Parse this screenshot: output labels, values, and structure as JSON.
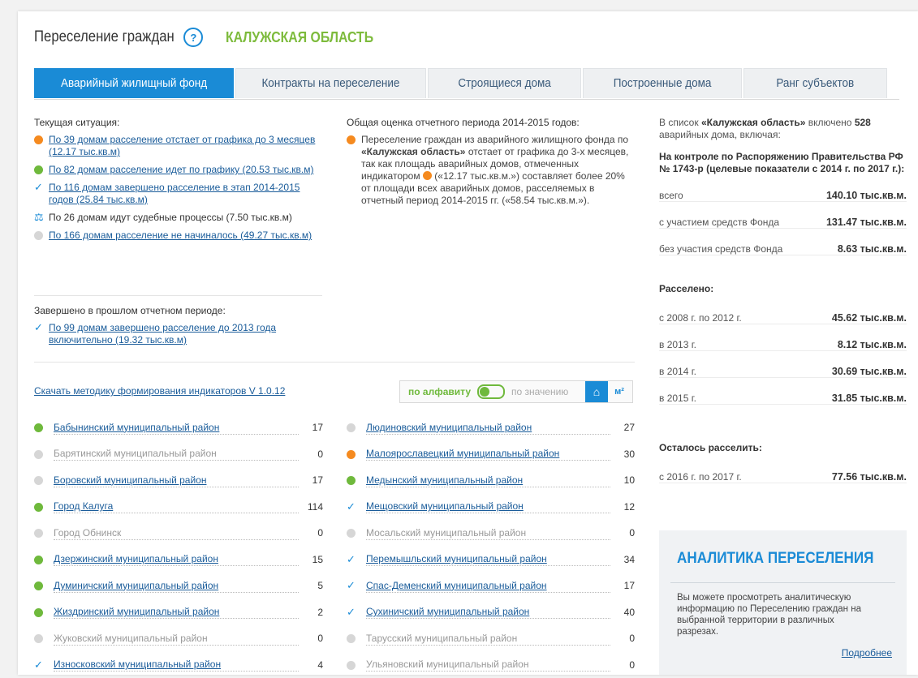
{
  "header": {
    "title": "Переселение граждан",
    "help": "?",
    "region": "КАЛУЖСКАЯ ОБЛАСТЬ"
  },
  "tabs": [
    "Аварийный жилищный фонд",
    "Контракты на переселение",
    "Строящиеся дома",
    "Построенные дома",
    "Ранг субъектов"
  ],
  "current": {
    "label": "Текущая ситуация:",
    "items": [
      {
        "icon": "orange-dot",
        "text": "По 39 домам расселение отстает от графика до 3 месяцев (12.17 тыс.кв.м)"
      },
      {
        "icon": "green-dot",
        "text": "По 82 домам расселение идет по графику (20.53 тыс.кв.м)"
      },
      {
        "icon": "check",
        "text": "По 116 домам завершено расселение в этап 2014-2015 годов (25.84 тыс.кв.м)"
      },
      {
        "icon": "scales",
        "text": "По 26 домам идут судебные процессы (7.50 тыс.кв.м)"
      },
      {
        "icon": "gray-dot",
        "text": "По 166 домам расселение не начиналось (49.27 тыс.кв.м)"
      }
    ],
    "prev_label": "Завершено в прошлом отчетном периоде:",
    "prev_item": "По 99 домам завершено расселение до 2013 года включительно (19.32 тыс.кв.м)"
  },
  "assessment": {
    "label": "Общая оценка отчетного периода 2014-2015 годов:",
    "p1": "Переселение граждан из аварийного жилищного фонда по ",
    "region_bold": "«Калужская область»",
    "p2": " отстает от графика до 3-х месяцев, так как площадь аварийных домов, отмеченных индикатором ",
    "p3": " («12.17 тыс.кв.м.») составляет более 20% от площади всех аварийных домов, расселяемых в отчетный период 2014-2015 гг. («58.54 тыс.кв.м.»)."
  },
  "summary": {
    "intro1": "В список ",
    "intro_region": "«Калужская область»",
    "intro2": " включено ",
    "intro_count": "528",
    "intro3": " аварийных дома, включая:",
    "control_title": "На контроле по Распоряжению Правительства РФ № 1743-р (целевые показатели с 2014 г. по 2017 г.):",
    "control_rows": [
      {
        "k": "всего",
        "v": "140.10 тыс.кв.м."
      },
      {
        "k": "с участием средств Фонда",
        "v": "131.47 тыс.кв.м."
      },
      {
        "k": "без участия средств Фонда",
        "v": "8.63 тыс.кв.м."
      }
    ],
    "resettled_title": "Расселено:",
    "resettled_rows": [
      {
        "k": "с 2008 г. по 2012 г.",
        "v": "45.62 тыс.кв.м."
      },
      {
        "k": "в 2013 г.",
        "v": "8.12 тыс.кв.м."
      },
      {
        "k": "в 2014 г.",
        "v": "30.69 тыс.кв.м."
      },
      {
        "k": "в 2015 г.",
        "v": "31.85 тыс.кв.м."
      }
    ],
    "remaining_title": "Осталось расселить:",
    "remaining_rows": [
      {
        "k": "с 2016 г. по 2017 г.",
        "v": "77.56 тыс.кв.м."
      }
    ]
  },
  "download": "Скачать методику формирования индикаторов  V 1.0.12",
  "sort": {
    "alpha": "по алфавиту",
    "value": "по значению",
    "home": "⌂",
    "unit": "м²"
  },
  "districts_left": [
    {
      "icon": "green",
      "name": "Бабынинский муниципальный район",
      "n": "17",
      "link": true
    },
    {
      "icon": "gray",
      "name": "Барятинский муниципальный район",
      "n": "0",
      "link": false
    },
    {
      "icon": "gray",
      "name": "Боровский муниципальный район",
      "n": "17",
      "link": true
    },
    {
      "icon": "green",
      "name": "Город Калуга",
      "n": "114",
      "link": true
    },
    {
      "icon": "gray",
      "name": "Город Обнинск",
      "n": "0",
      "link": false
    },
    {
      "icon": "green",
      "name": "Дзержинский муниципальный район",
      "n": "15",
      "link": true
    },
    {
      "icon": "green",
      "name": "Думиничский муниципальный район",
      "n": "5",
      "link": true
    },
    {
      "icon": "green",
      "name": "Жиздринский муниципальный район",
      "n": "2",
      "link": true
    },
    {
      "icon": "gray",
      "name": "Жуковский муниципальный район",
      "n": "0",
      "link": false
    },
    {
      "icon": "check",
      "name": "Износковский муниципальный район",
      "n": "4",
      "link": true
    }
  ],
  "districts_right": [
    {
      "icon": "gray",
      "name": "Людиновский муниципальный район",
      "n": "27",
      "link": true
    },
    {
      "icon": "orange",
      "name": "Малоярославецкий муниципальный район",
      "n": "30",
      "link": true
    },
    {
      "icon": "green",
      "name": "Медынский муниципальный район",
      "n": "10",
      "link": true
    },
    {
      "icon": "check",
      "name": "Мещовский муниципальный район",
      "n": "12",
      "link": true
    },
    {
      "icon": "gray",
      "name": "Мосальский муниципальный район",
      "n": "0",
      "link": false
    },
    {
      "icon": "check",
      "name": "Перемышльский муниципальный район",
      "n": "34",
      "link": true
    },
    {
      "icon": "check",
      "name": "Спас-Деменский муниципальный район",
      "n": "17",
      "link": true
    },
    {
      "icon": "check",
      "name": "Сухиничский муниципальный район",
      "n": "40",
      "link": true
    },
    {
      "icon": "gray",
      "name": "Тарусский муниципальный район",
      "n": "0",
      "link": false
    },
    {
      "icon": "gray",
      "name": "Ульяновский муниципальный район",
      "n": "0",
      "link": false
    }
  ],
  "analytics": {
    "title": "АНАЛИТИКА ПЕРЕСЕЛЕНИЯ",
    "text": "Вы можете просмотреть аналитическую информацию по Переселению граждан на выбранной территории в различных разрезах.",
    "more": "Подробнее"
  }
}
